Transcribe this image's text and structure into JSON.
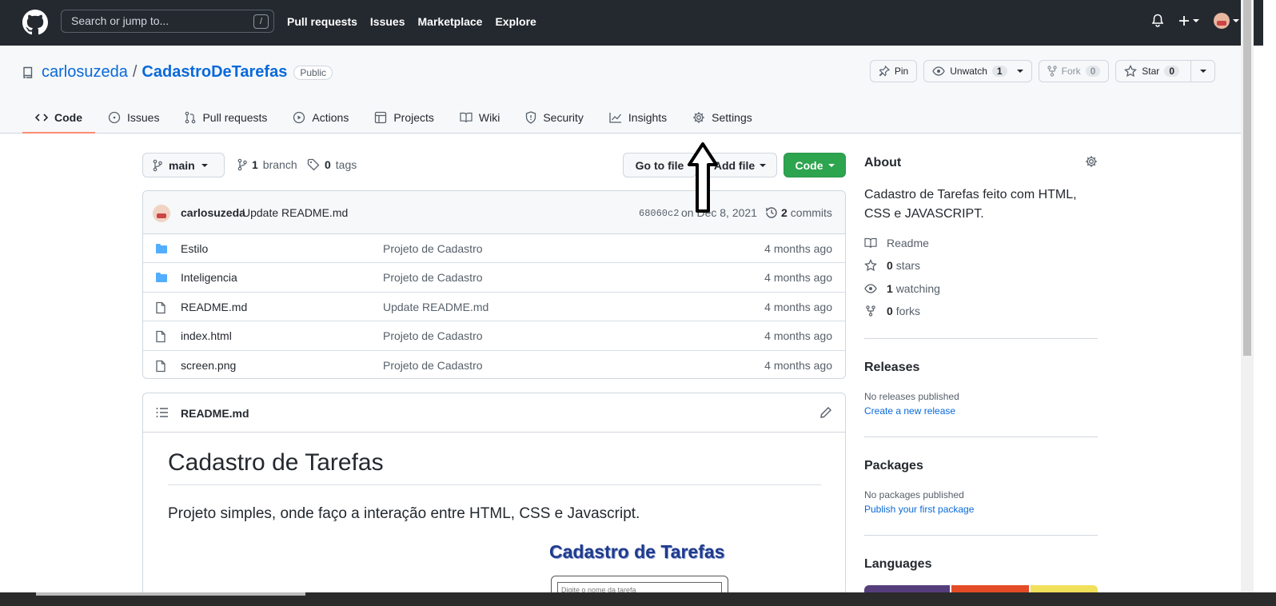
{
  "header": {
    "search_placeholder": "Search or jump to...",
    "search_shortcut": "/",
    "nav": [
      "Pull requests",
      "Issues",
      "Marketplace",
      "Explore"
    ]
  },
  "repo": {
    "owner": "carlosuzeda",
    "separator": "/",
    "name": "CadastroDeTarefas",
    "visibility": "Public",
    "actions": {
      "pin": "Pin",
      "unwatch": "Unwatch",
      "unwatch_count": "1",
      "fork": "Fork",
      "fork_count": "0",
      "star": "Star",
      "star_count": "0"
    },
    "tabs": [
      "Code",
      "Issues",
      "Pull requests",
      "Actions",
      "Projects",
      "Wiki",
      "Security",
      "Insights",
      "Settings"
    ]
  },
  "toolbar": {
    "branch": "main",
    "branches_count": "1",
    "branches_label": "branch",
    "tags_count": "0",
    "tags_label": "tags",
    "go_to_file": "Go to file",
    "add_file": "Add file",
    "code": "Code"
  },
  "commit": {
    "author": "carlosuzeda",
    "message": "Update README.md",
    "sha": "68060c2",
    "date": "on Dec 8, 2021",
    "count": "2",
    "count_label": "commits"
  },
  "files": [
    {
      "type": "folder",
      "name": "Estilo",
      "message": "Projeto de Cadastro",
      "age": "4 months ago"
    },
    {
      "type": "folder",
      "name": "Inteligencia",
      "message": "Projeto de Cadastro",
      "age": "4 months ago"
    },
    {
      "type": "file",
      "name": "README.md",
      "message": "Update README.md",
      "age": "4 months ago"
    },
    {
      "type": "file",
      "name": "index.html",
      "message": "Projeto de Cadastro",
      "age": "4 months ago"
    },
    {
      "type": "file",
      "name": "screen.png",
      "message": "Projeto de Cadastro",
      "age": "4 months ago"
    }
  ],
  "readme": {
    "filename": "README.md",
    "heading": "Cadastro de Tarefas",
    "paragraph": "Projeto simples, onde faço a interação entre HTML, CSS e Javascript.",
    "screenshot_title": "Cadastro de Tarefas",
    "screenshot_input_placeholder": "Digite o nome da tarefa"
  },
  "about": {
    "title": "About",
    "description": "Cadastro de Tarefas feito com HTML, CSS e JAVASCRIPT.",
    "readme": "Readme",
    "stars_count": "0",
    "stars_label": "stars",
    "watching_count": "1",
    "watching_label": "watching",
    "forks_count": "0",
    "forks_label": "forks"
  },
  "releases": {
    "title": "Releases",
    "empty": "No releases published",
    "link": "Create a new release"
  },
  "packages": {
    "title": "Packages",
    "empty": "No packages published",
    "link": "Publish your first package"
  },
  "languages": {
    "title": "Languages",
    "colors": [
      "#563d7c",
      "#e34c26",
      "#f1e05a"
    ]
  }
}
